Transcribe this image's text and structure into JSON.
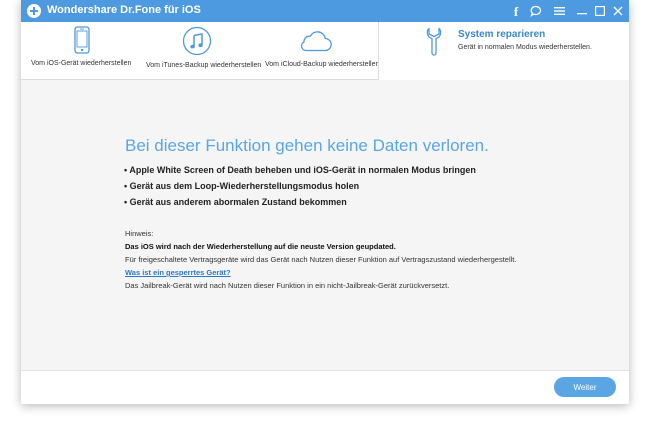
{
  "window": {
    "title": "Wondershare Dr.Fone für iOS"
  },
  "titlebar_icons": [
    {
      "name": "facebook-icon",
      "glyph": "f"
    },
    {
      "name": "feedback-icon",
      "glyph": "◯"
    },
    {
      "name": "menu-icon",
      "glyph": "≡"
    },
    {
      "name": "minimize-icon",
      "glyph": "—"
    },
    {
      "name": "maximize-icon",
      "glyph": "☐"
    },
    {
      "name": "close-icon",
      "glyph": "✕"
    }
  ],
  "tabs": [
    {
      "label": "Vom iOS-Gerät wiederherstellen",
      "icon": "phone-icon"
    },
    {
      "label": "Vom iTunes-Backup wiederherstellen",
      "icon": "itunes-music-icon"
    },
    {
      "label": "Vom iCloud-Backup wiederherstellen",
      "icon": "cloud-icon"
    }
  ],
  "active_tab": {
    "title": "System reparieren",
    "subtitle": "Gerät in normalen Modus wiederherstellen.",
    "icon": "wrench-icon"
  },
  "main": {
    "headline": "Bei dieser Funktion gehen keine Daten verloren.",
    "bullets": [
      "• Apple White Screen of Death beheben und iOS-Gerät in normalen Modus bringen",
      "• Gerät aus dem Loop-Wiederherstellungsmodus holen",
      "• Gerät aus anderem abormalen Zustand bekommen"
    ],
    "note": {
      "heading": "Hinweis:",
      "bold_line": "Das iOS wird nach der Wiederherstellung auf die neuste Version geupdated.",
      "line1": "Für freigeschaltete Vertragsgeräte wird das Gerät nach Nutzen dieser Funktion auf Vertragszustand wiederhergestellt.",
      "link": "Was ist ein gesperrtes Gerät?",
      "line2": "Das Jailbreak-Gerät wird nach Nutzen dieser Funktion in ein nicht-Jailbreak-Gerät zurückversetzt."
    }
  },
  "footer": {
    "next_label": "Weiter"
  },
  "colors": {
    "titlebar": "#4d9ae0",
    "accent": "#5aa6e4",
    "active_title": "#3a87cd",
    "link": "#2a78c8"
  }
}
